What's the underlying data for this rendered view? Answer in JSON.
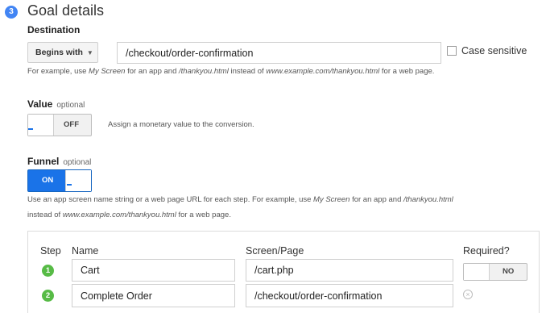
{
  "section": {
    "step_number": "3",
    "title": "Goal details"
  },
  "destination": {
    "label": "Destination",
    "match_type": "Begins with",
    "value": "/checkout/order-confirmation",
    "case_sensitive_label": "Case sensitive",
    "case_sensitive_checked": false,
    "help": {
      "p1": "For example, use ",
      "i1": "My Screen",
      "p2": " for an app and ",
      "i2": "/thankyou.html",
      "p3": " instead of ",
      "i3": "www.example.com/thankyou.html",
      "p4": " for a web page."
    }
  },
  "value": {
    "label": "Value",
    "optional": "optional",
    "toggle_text": "OFF",
    "toggle_on": false,
    "help": "Assign a monetary value to the conversion."
  },
  "funnel": {
    "label": "Funnel",
    "optional": "optional",
    "toggle_text": "ON",
    "toggle_on": true,
    "help1": {
      "p1": "Use an app screen name string or a web page URL for each step. For example, use ",
      "i1": "My Screen",
      "p2": " for an app and ",
      "i2": "/thankyou.html"
    },
    "help2": {
      "p1": "instead of ",
      "i1": "www.example.com/thankyou.html",
      "p2": " for a web page."
    },
    "columns": {
      "step": "Step",
      "name": "Name",
      "page": "Screen/Page",
      "required": "Required?"
    },
    "steps": [
      {
        "number": "1",
        "name": "Cart",
        "page": "/cart.php"
      },
      {
        "number": "2",
        "name": "Complete Order",
        "page": "/checkout/order-confirmation"
      }
    ],
    "required_toggle_text": "NO",
    "required_on": false,
    "remove_icon": "clear-circle-icon"
  },
  "colors": {
    "accent_blue": "#1a73e8",
    "step_badge": "#4285f4",
    "funnel_step_green": "#57bb46"
  }
}
